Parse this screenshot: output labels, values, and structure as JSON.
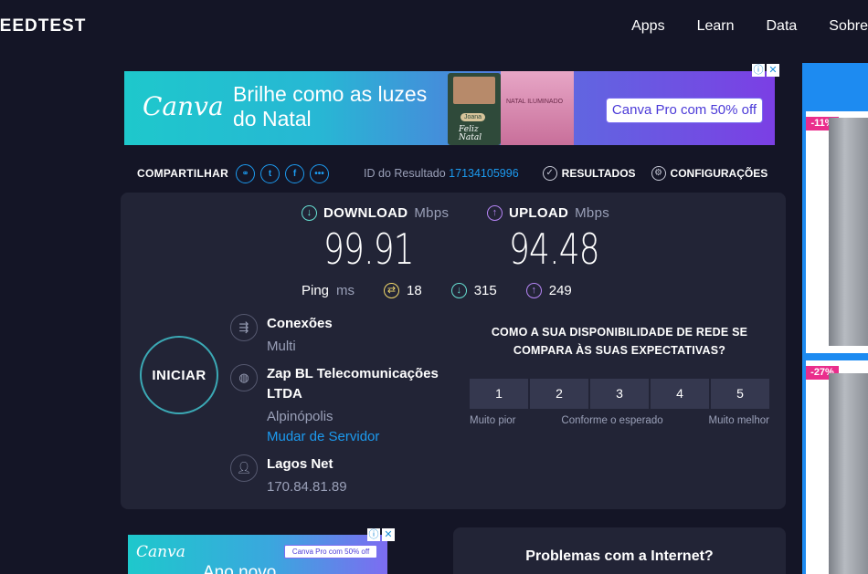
{
  "header": {
    "brand": "PEEDTEST",
    "nav": [
      "Apps",
      "Learn",
      "Data",
      "Sobre"
    ]
  },
  "ad_top": {
    "logo": "Canva",
    "headline": "Brilhe como as luzes do Natal",
    "card1_pill": "Joana",
    "card1_text": "Feliz Natal",
    "card2_text": "NATAL ILUMINADO",
    "cta": "Canva Pro com 50% off",
    "icons": [
      "info-icon",
      "close-icon"
    ]
  },
  "side_ad": {
    "badge1": "-11%",
    "badge2": "-27%"
  },
  "share": {
    "label": "COMPARTILHAR",
    "icons": [
      "link-icon",
      "twitter-icon",
      "facebook-icon",
      "more-icon"
    ],
    "result_label": "ID do Resultado",
    "result_id": "17134105996",
    "results_label": "RESULTADOS",
    "settings_label": "CONFIGURAÇÕES"
  },
  "download": {
    "label": "DOWNLOAD",
    "unit": "Mbps",
    "value": "99.91"
  },
  "upload": {
    "label": "UPLOAD",
    "unit": "Mbps",
    "value": "94.48"
  },
  "ping": {
    "label": "Ping",
    "unit": "ms",
    "idle": "18",
    "download": "315",
    "upload": "249"
  },
  "go_button": "INICIAR",
  "connections": {
    "title": "Conexões",
    "value": "Multi"
  },
  "server": {
    "name": "Zap BL Telecomunicações LTDA",
    "city": "Alpinópolis",
    "change_link": "Mudar de Servidor"
  },
  "isp": {
    "name": "Lagos Net",
    "ip": "170.84.81.89"
  },
  "survey": {
    "question": "COMO A SUA DISPONIBILIDADE DE REDE SE COMPARA ÀS SUAS EXPECTATIVAS?",
    "options": [
      "1",
      "2",
      "3",
      "4",
      "5"
    ],
    "low_label": "Muito pior",
    "mid_label": "Conforme o esperado",
    "high_label": "Muito melhor"
  },
  "ad_bottom": {
    "logo": "Canva",
    "cta": "Canva Pro com 50% off",
    "line2": "Ano novo"
  },
  "problems": {
    "title": "Problemas com a Internet?"
  },
  "colors": {
    "background": "#141526",
    "panel": "#222436",
    "accent": "#1c9bf0",
    "download": "#67e0d3",
    "upload": "#b685f6",
    "ping": "#f1d86b"
  }
}
